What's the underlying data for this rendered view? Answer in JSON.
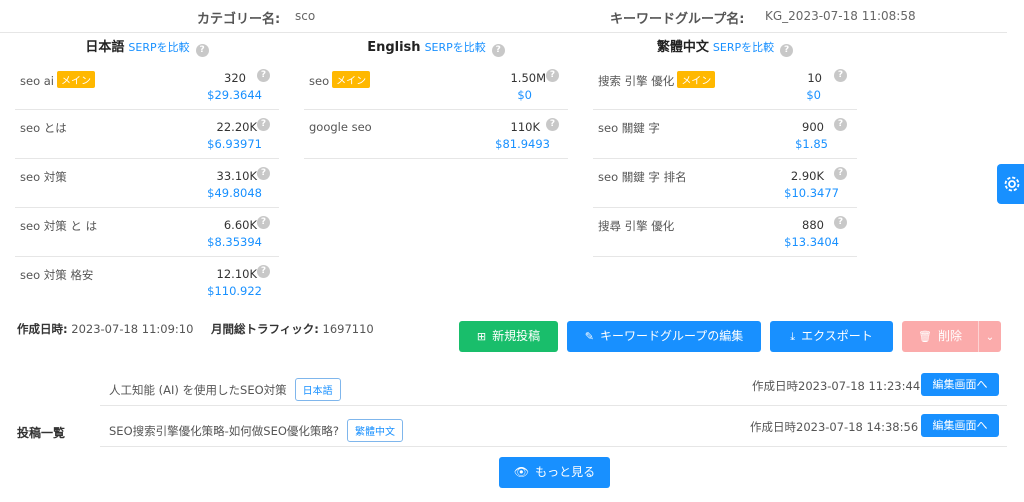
{
  "header": {
    "category_label": "カテゴリー名:",
    "category_value": "sco",
    "group_label": "キーワードグループ名:",
    "group_value": "KG_2023-07-18 11:08:58"
  },
  "columns": [
    {
      "lang": "日本語",
      "serp": "SERPを比較",
      "rows": [
        {
          "name": "seo ai",
          "badge": "メイン",
          "volume": "320",
          "cpc": "$29.3644"
        },
        {
          "name": "seo とは",
          "badge": "",
          "volume": "22.20K",
          "cpc": "$6.93971"
        },
        {
          "name": "seo 対策",
          "badge": "",
          "volume": "33.10K",
          "cpc": "$49.8048"
        },
        {
          "name": "seo 対策 と は",
          "badge": "",
          "volume": "6.60K",
          "cpc": "$8.35394"
        },
        {
          "name": "seo 対策 格安",
          "badge": "",
          "volume": "12.10K",
          "cpc": "$110.922"
        }
      ]
    },
    {
      "lang": "English",
      "serp": "SERPを比較",
      "rows": [
        {
          "name": "seo",
          "badge": "メイン",
          "volume": "1.50M",
          "cpc": "$0"
        },
        {
          "name": "google seo",
          "badge": "",
          "volume": "110K",
          "cpc": "$81.9493"
        }
      ]
    },
    {
      "lang": "繁體中文",
      "serp": "SERPを比較",
      "rows": [
        {
          "name": "搜索 引擎 優化",
          "badge": "メイン",
          "volume": "10",
          "cpc": "$0"
        },
        {
          "name": "seo 關鍵 字",
          "badge": "",
          "volume": "900",
          "cpc": "$1.85"
        },
        {
          "name": "seo 關鍵 字 排名",
          "badge": "",
          "volume": "2.90K",
          "cpc": "$10.3477"
        },
        {
          "name": "搜尋 引擎 優化",
          "badge": "",
          "volume": "880",
          "cpc": "$13.3404"
        }
      ]
    }
  ],
  "meta": {
    "created_label": "作成日時:",
    "created_value": "2023-07-18 11:09:10",
    "traffic_label": "月間総トラフィック:",
    "traffic_value": "1697110"
  },
  "actions": {
    "new_post": "新規投稿",
    "edit_group": "キーワードグループの編集",
    "export": "エクスポート",
    "delete": "削除"
  },
  "colors": {
    "green": "#19be6b",
    "blue": "#1890ff",
    "disabled_red": "#fbabab",
    "badge": "#ffb800"
  },
  "posts": {
    "label": "投稿一覧",
    "items": [
      {
        "title": "人工知能 (AI) を使用したSEO対策",
        "lang": "日本語",
        "date": "作成日時2023-07-18 11:23:44",
        "edit": "編集画面へ"
      },
      {
        "title": "SEO搜索引擎優化策略-如何做SEO優化策略?",
        "lang": "繁體中文",
        "date": "作成日時2023-07-18 14:38:56",
        "edit": "編集画面へ"
      }
    ],
    "more": "もっと見る"
  },
  "icons": {
    "help": "question-circle-icon",
    "settings": "gear-icon",
    "new_post": "file-plus-icon",
    "edit": "edit-icon",
    "export": "download-icon",
    "delete": "trash-icon",
    "more": "eye-icon",
    "dropdown": "chevron-down-icon"
  }
}
